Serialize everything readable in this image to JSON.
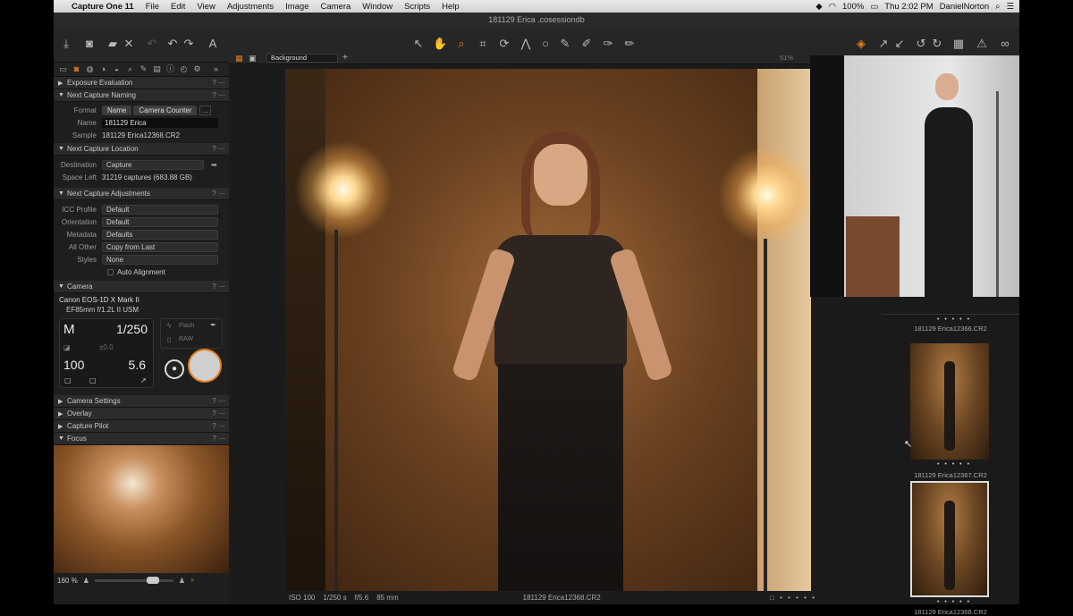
{
  "menubar": {
    "app": "Capture One 11",
    "items": [
      "File",
      "Edit",
      "View",
      "Adjustments",
      "Image",
      "Camera",
      "Window",
      "Scripts",
      "Help"
    ],
    "battery": "100%",
    "clock": "Thu 2:02 PM",
    "user": "DanielNorton"
  },
  "window": {
    "title": "181129 Erica .cosessiondb"
  },
  "viewer_bar": {
    "background_select": "Background",
    "zoom": "51%"
  },
  "left": {
    "sections": {
      "exposure": "Exposure Evaluation",
      "naming": "Next Capture Naming",
      "location": "Next Capture Location",
      "adjustments": "Next Capture Adjustments",
      "camera": "Camera",
      "camera_settings": "Camera Settings",
      "overlay": "Overlay",
      "capture_pilot": "Capture Pilot",
      "focus": "Focus"
    },
    "naming": {
      "format_label": "Format",
      "tok1": "Name",
      "tok2": "Camera Counter",
      "more": "...",
      "name_label": "Name",
      "name_value": "181129 Erica",
      "sample_label": "Sample",
      "sample_value": "181129 Erica12368.CR2"
    },
    "location": {
      "dest_label": "Destination",
      "dest_value": "Capture",
      "space_label": "Space Left",
      "space_value": "31219 captures (683.88 GB)"
    },
    "adjust": {
      "icc_label": "ICC Profile",
      "icc_value": "Default",
      "orient_label": "Orientation",
      "orient_value": "Default",
      "meta_label": "Metadata",
      "meta_value": "Defaults",
      "allother_label": "All Other",
      "allother_value": "Copy from Last",
      "styles_label": "Styles",
      "styles_value": "None",
      "auto_align": "Auto Alignment"
    },
    "camera": {
      "model": "Canon EOS-1D X Mark II",
      "lens": "EF85mm f/1.2L II USM",
      "mode": "M",
      "shutter": "1/250",
      "ev": "±0.0",
      "iso": "100",
      "aperture": "5.6",
      "flash": "Flash",
      "raw": "RAW"
    },
    "focus": {
      "zoom": "160 %"
    }
  },
  "status": {
    "iso": "ISO 100",
    "shutter": "1/250 s",
    "aperture": "f/5.6",
    "focal": "85 mm",
    "filename": "181129 Erica12368.CR2"
  },
  "browser": {
    "thumbs": [
      {
        "name": "181129 Erica12368.CR2"
      },
      {
        "name": "181129 Erica12367.CR2"
      },
      {
        "name": "181129 Erica12366.CR2"
      }
    ]
  },
  "colors": {
    "accent": "#e37d1c"
  }
}
